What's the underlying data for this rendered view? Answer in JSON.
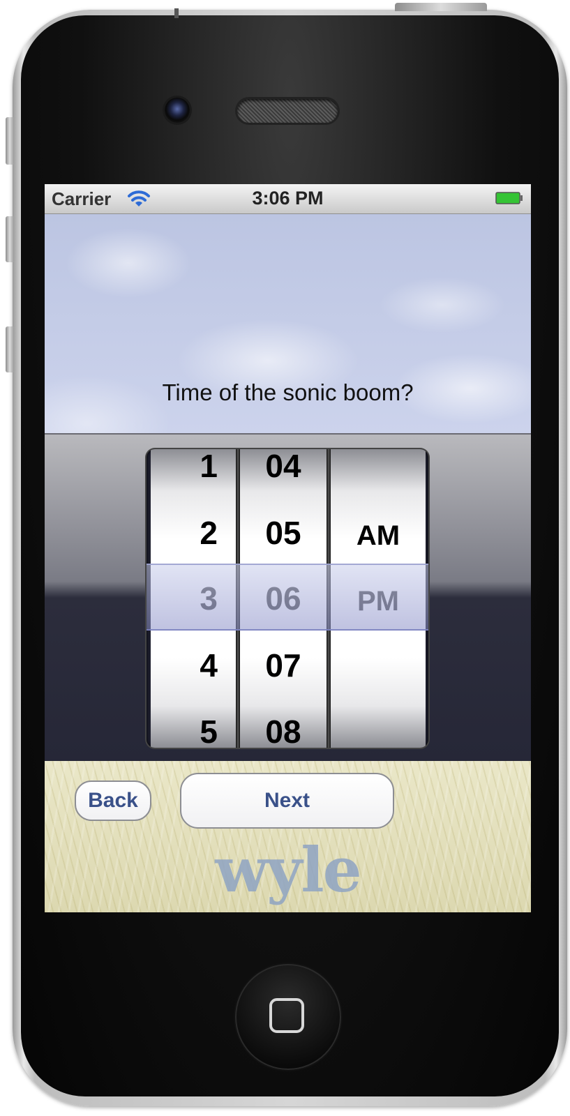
{
  "status_bar": {
    "carrier": "Carrier",
    "time": "3:06 PM"
  },
  "question": "Time of the sonic boom?",
  "picker": {
    "hours": [
      "1",
      "2",
      "3",
      "4",
      "5"
    ],
    "minutes": [
      "04",
      "05",
      "06",
      "07",
      "08"
    ],
    "ampm": [
      "AM",
      "PM"
    ],
    "selected": {
      "hour": "3",
      "minute": "06",
      "ampm": "PM"
    }
  },
  "buttons": {
    "back": "Back",
    "next": "Next"
  },
  "logo": "wyle",
  "colors": {
    "button_text": "#3a5189",
    "logo": "#8fa4c3",
    "battery": "#35c435"
  }
}
